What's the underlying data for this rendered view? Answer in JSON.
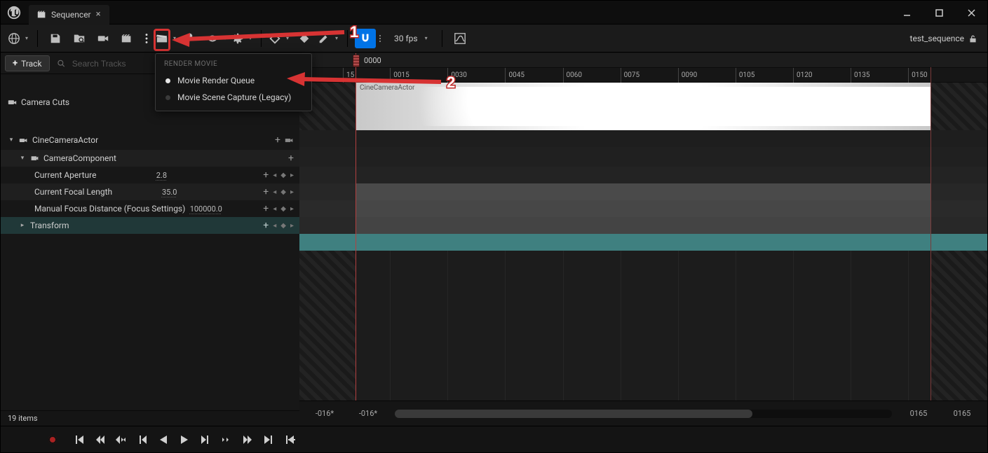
{
  "title_bar": {
    "tab_label": "Sequencer"
  },
  "toolbar": {
    "fps_label": "30 fps",
    "sequence_name": "test_sequence"
  },
  "popup": {
    "heading": "RENDER MOVIE",
    "item1": "Movie Render Queue",
    "item2": "Movie Scene Capture (Legacy)"
  },
  "annotations": {
    "n1": "1",
    "n2": "2"
  },
  "tree": {
    "add_track_label": "Track",
    "search_placeholder": "Search Tracks",
    "camera_cuts": "Camera Cuts",
    "cine_camera": "CineCameraActor",
    "camera_component": "CameraComponent",
    "aperture": {
      "label": "Current Aperture",
      "value": "2.8"
    },
    "focal": {
      "label": "Current Focal Length",
      "value": "35.0"
    },
    "focus": {
      "label": "Manual Focus Distance (Focus Settings)",
      "value": "100000.0"
    },
    "transform": "Transform",
    "status": "19 items"
  },
  "timeline": {
    "current_frame": "0000",
    "thumb_label": "CineCameraActor",
    "ticks": [
      "15",
      "0015",
      "0030",
      "0045",
      "0060",
      "0075",
      "0090",
      "0105",
      "0120",
      "0135",
      "0150"
    ],
    "bottom_left_a": "-016*",
    "bottom_left_b": "-016*",
    "bottom_right_a": "0165",
    "bottom_right_b": "0165"
  }
}
